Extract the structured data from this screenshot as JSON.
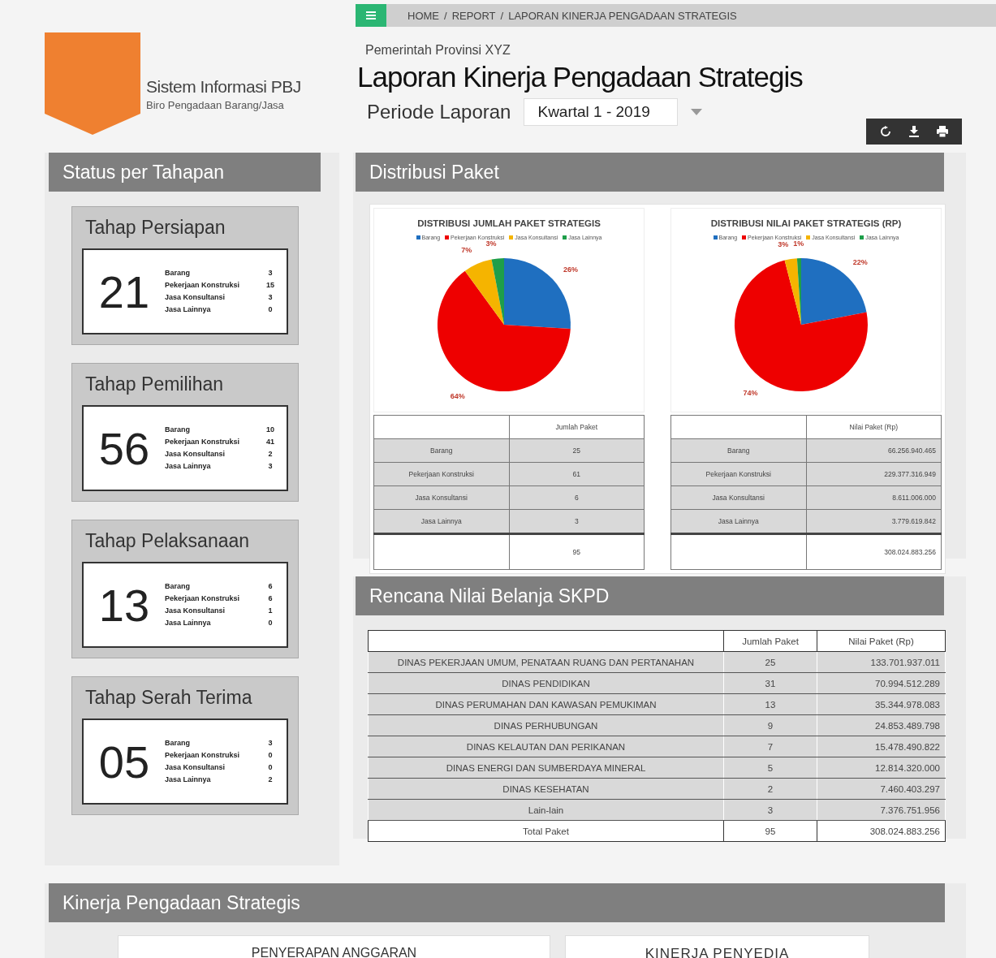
{
  "breadcrumb": {
    "separator": "/",
    "items": [
      "HOME",
      "REPORT",
      "LAPORAN KINERJA PENGADAAN STRATEGIS"
    ]
  },
  "brand": {
    "title": "Sistem Informasi PBJ",
    "subtitle": "Biro Pengadaan Barang/Jasa"
  },
  "header": {
    "organization": "Pemerintah Provinsi XYZ",
    "title": "Laporan Kinerja Pengadaan Strategis",
    "period_label": "Periode Laporan",
    "period_value": "Kwartal 1 - 2019"
  },
  "status_panel": {
    "title": "Status per Tahapan",
    "stages": [
      {
        "title": "Tahap Persiapan",
        "total": "21",
        "items": [
          {
            "label": "Barang",
            "count": "3"
          },
          {
            "label": "Pekerjaan Konstruksi",
            "count": "15"
          },
          {
            "label": "Jasa Konsultansi",
            "count": "3"
          },
          {
            "label": "Jasa Lainnya",
            "count": "0"
          }
        ]
      },
      {
        "title": "Tahap Pemilihan",
        "total": "56",
        "items": [
          {
            "label": "Barang",
            "count": "10"
          },
          {
            "label": "Pekerjaan Konstruksi",
            "count": "41"
          },
          {
            "label": "Jasa Konsultansi",
            "count": "2"
          },
          {
            "label": "Jasa Lainnya",
            "count": "3"
          }
        ]
      },
      {
        "title": "Tahap Pelaksanaan",
        "total": "13",
        "items": [
          {
            "label": "Barang",
            "count": "6"
          },
          {
            "label": "Pekerjaan Konstruksi",
            "count": "6"
          },
          {
            "label": "Jasa Konsultansi",
            "count": "1"
          },
          {
            "label": "Jasa Lainnya",
            "count": "0"
          }
        ]
      },
      {
        "title": "Tahap Serah Terima",
        "total": "05",
        "items": [
          {
            "label": "Barang",
            "count": "3"
          },
          {
            "label": "Pekerjaan Konstruksi",
            "count": "0"
          },
          {
            "label": "Jasa Konsultansi",
            "count": "0"
          },
          {
            "label": "Jasa Lainnya",
            "count": "2"
          }
        ]
      }
    ]
  },
  "distribution_panel": {
    "title": "Distribusi Paket",
    "charts": [
      {
        "chart_data": {
          "type": "pie",
          "title": "DISTRIBUSI JUMLAH PAKET STRATEGIS",
          "categories": [
            "Barang",
            "Pekerjaan Konstruksi",
            "Jasa Konsultansi",
            "Jasa Lainnya"
          ],
          "values": [
            26,
            64,
            7,
            3
          ],
          "value_labels": [
            "26%",
            "64%",
            "7%",
            "3%"
          ],
          "legend": "top"
        },
        "table": {
          "column_header": "Jumlah Paket",
          "rows": [
            {
              "label": "Barang",
              "value": "25"
            },
            {
              "label": "Pekerjaan Konstruksi",
              "value": "61"
            },
            {
              "label": "Jasa Konsultansi",
              "value": "6"
            },
            {
              "label": "Jasa Lainnya",
              "value": "3"
            }
          ],
          "total": "95"
        }
      },
      {
        "chart_data": {
          "type": "pie",
          "title": "DISTRIBUSI NILAI PAKET STRATEGIS (RP)",
          "categories": [
            "Barang",
            "Pekerjaan Konstruksi",
            "Jasa Konsultansi",
            "Jasa Lainnya"
          ],
          "values": [
            22,
            74,
            3,
            1
          ],
          "value_labels": [
            "22%",
            "74%",
            "3%",
            "1%"
          ],
          "legend": "top"
        },
        "table": {
          "column_header": "Nilai Paket (Rp)",
          "rows": [
            {
              "label": "Barang",
              "value": "66.256.940.465"
            },
            {
              "label": "Pekerjaan Konstruksi",
              "value": "229.377.316.949"
            },
            {
              "label": "Jasa Konsultansi",
              "value": "8.611.006.000"
            },
            {
              "label": "Jasa Lainnya",
              "value": "3.779.619.842"
            }
          ],
          "total": "308.024.883.256"
        }
      }
    ]
  },
  "budget_panel": {
    "title": "Rencana Nilai Belanja SKPD",
    "columns": [
      "Jumlah Paket",
      "Nilai Paket (Rp)"
    ],
    "rows": [
      {
        "name": "DINAS PEKERJAAN UMUM, PENATAAN RUANG DAN PERTANAHAN",
        "count": "25",
        "value": "133.701.937.011"
      },
      {
        "name": "DINAS PENDIDIKAN",
        "count": "31",
        "value": "70.994.512.289"
      },
      {
        "name": "DINAS PERUMAHAN DAN KAWASAN PEMUKIMAN",
        "count": "13",
        "value": "35.344.978.083"
      },
      {
        "name": "DINAS PERHUBUNGAN",
        "count": "9",
        "value": "24.853.489.798"
      },
      {
        "name": "DINAS KELAUTAN DAN PERIKANAN",
        "count": "7",
        "value": "15.478.490.822"
      },
      {
        "name": "DINAS ENERGI DAN SUMBERDAYA MINERAL",
        "count": "5",
        "value": "12.814.320.000"
      },
      {
        "name": "DINAS KESEHATAN",
        "count": "2",
        "value": "7.460.403.297"
      },
      {
        "name": "Lain-lain",
        "count": "3",
        "value": "7.376.751.956"
      }
    ],
    "total": {
      "label": "Total Paket",
      "count": "95",
      "value": "308.024.883.256"
    }
  },
  "performance_panel": {
    "title": "Kinerja Pengadaan Strategis",
    "cards": [
      "PENYERAPAN ANGGARAN",
      "KINERJA PENYEDIA"
    ]
  }
}
